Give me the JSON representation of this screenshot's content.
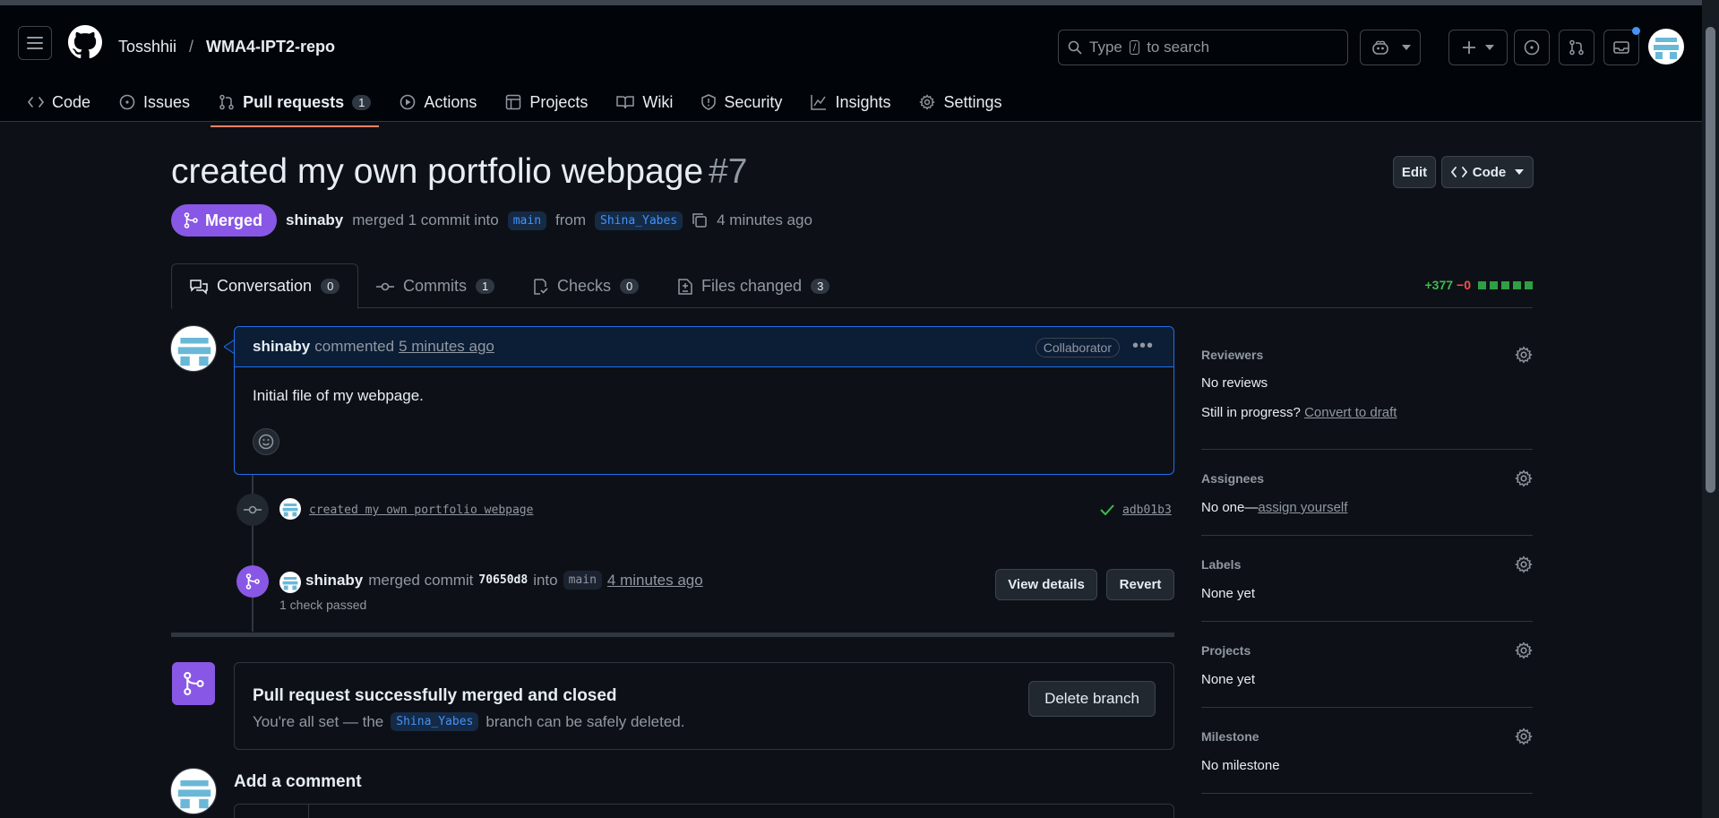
{
  "header": {
    "owner": "Tosshhii",
    "separator": "/",
    "repo": "WMA4-IPT2-repo",
    "search_placeholder_pre": "Type",
    "search_key": "/",
    "search_placeholder_post": "to search"
  },
  "repo_nav": {
    "tabs": [
      {
        "label": "Code",
        "icon": "code-icon"
      },
      {
        "label": "Issues",
        "icon": "issue-icon"
      },
      {
        "label": "Pull requests",
        "icon": "pull-request-icon",
        "count": "1",
        "active": true
      },
      {
        "label": "Actions",
        "icon": "play-icon"
      },
      {
        "label": "Projects",
        "icon": "table-icon"
      },
      {
        "label": "Wiki",
        "icon": "book-icon"
      },
      {
        "label": "Security",
        "icon": "shield-icon"
      },
      {
        "label": "Insights",
        "icon": "graph-icon"
      },
      {
        "label": "Settings",
        "icon": "gear-icon"
      }
    ]
  },
  "pr": {
    "title": "created my own portfolio webpage",
    "number": "#7",
    "edit_label": "Edit",
    "code_label": "Code",
    "state": "Merged",
    "author": "shinaby",
    "merge_text": "merged 1 commit into",
    "base_branch": "main",
    "from_text": "from",
    "head_branch": "Shina_Yabes",
    "time_ago": "4 minutes ago"
  },
  "pr_tabs": [
    {
      "label": "Conversation",
      "count": "0",
      "icon": "comment-discussion-icon"
    },
    {
      "label": "Commits",
      "count": "1",
      "icon": "commit-icon"
    },
    {
      "label": "Checks",
      "count": "0",
      "icon": "checklist-icon"
    },
    {
      "label": "Files changed",
      "count": "3",
      "icon": "file-diff-icon"
    }
  ],
  "diffstat": {
    "additions": "+377",
    "deletions": "−0"
  },
  "comment": {
    "author": "shinaby",
    "verb": "commented",
    "time": "5 minutes ago",
    "role": "Collaborator",
    "body": "Initial file of my webpage."
  },
  "timeline": {
    "commit_message": "created my own portfolio webpage",
    "commit_sha": "adb01b3",
    "merge_author": "shinaby",
    "merge_verb": "merged commit",
    "merge_sha": "70650d8",
    "merge_into": "into",
    "merge_branch": "main",
    "merge_time": "4 minutes ago",
    "view_details": "View details",
    "revert": "Revert",
    "checks": "1 check passed"
  },
  "merged_box": {
    "title": "Pull request successfully merged and closed",
    "desc_pre": "You're all set — the",
    "branch": "Shina_Yabes",
    "desc_post": "branch can be safely deleted.",
    "delete_label": "Delete branch"
  },
  "add_comment": "Add a comment",
  "sidebar": {
    "reviewers": {
      "title": "Reviewers",
      "value": "No reviews",
      "draft_pre": "Still in progress?",
      "draft_link": "Convert to draft"
    },
    "assignees": {
      "title": "Assignees",
      "value_pre": "No one—",
      "value_link": "assign yourself"
    },
    "labels": {
      "title": "Labels",
      "value": "None yet"
    },
    "projects": {
      "title": "Projects",
      "value": "None yet"
    },
    "milestone": {
      "title": "Milestone",
      "value": "No milestone"
    }
  },
  "colors": {
    "merged": "#8957e5",
    "accent": "#1f6feb",
    "success": "#3fb950",
    "danger": "#f85149",
    "background": "#0d1117"
  }
}
